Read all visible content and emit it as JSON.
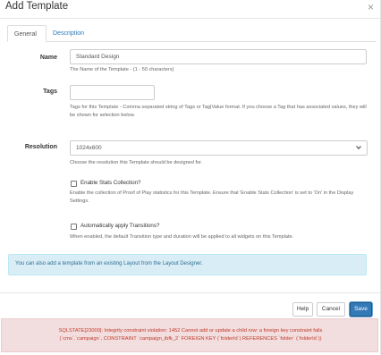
{
  "dialog": {
    "title": "Add Template",
    "close_glyph": "×"
  },
  "tabs": [
    {
      "label": "General",
      "active": true
    },
    {
      "label": "Description",
      "active": false
    }
  ],
  "form": {
    "name": {
      "label": "Name",
      "value": "Standard Design",
      "help": "The Name of the Template - (1 - 50 characters)"
    },
    "tags": {
      "label": "Tags",
      "value": "",
      "help": "Tags for this Template - Comma separated string of Tags or Tag|Value format. If you choose a Tag that has associated values, they will be shown for selection below."
    },
    "resolution": {
      "label": "Resolution",
      "selected": "1024x600",
      "help": "Choose the resolution this Template should be designed for."
    },
    "enable_stats": {
      "label": "Enable Stats Collection?",
      "checked": false,
      "help": "Enable the collection of Proof of Play statistics for this Template. Ensure that 'Enable Stats Collection' is set to 'On' in the Display Settings."
    },
    "auto_transitions": {
      "label": "Automatically apply Transitions?",
      "checked": false,
      "help": "When enabled, the default Transition type and duration will be applied to all widgets on this Template."
    }
  },
  "info": {
    "text": "You can also add a template from an existing Layout from the Layout Designer."
  },
  "buttons": {
    "help": "Help",
    "cancel": "Cancel",
    "save": "Save"
  },
  "error": {
    "line1": "SQLSTATE[23000]: Integrity constraint violation: 1452 Cannot add or update a child row: a foreign key constraint fails",
    "line2": "(`cms`.`campaign`, CONSTRAINT `campaign_ibfk_2` FOREIGN KEY (`folderId`) REFERENCES `folder` (`folderId`))"
  },
  "colors": {
    "link": "#2a7bb8",
    "primary": "#337ab7",
    "info_bg": "#d9edf7",
    "error_bg": "#f2dede",
    "error_text": "#c0392b"
  },
  "icons": {
    "close": "close-icon",
    "select": "chevron-down-icon"
  }
}
